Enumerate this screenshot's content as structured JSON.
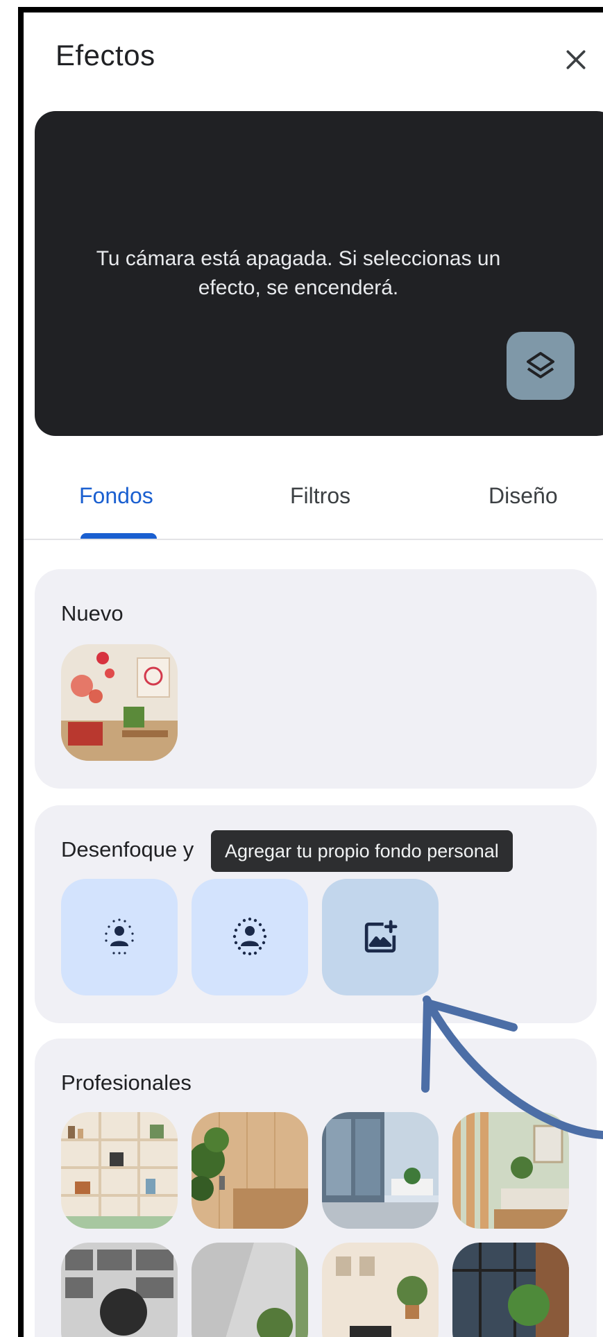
{
  "header": {
    "title": "Efectos"
  },
  "preview": {
    "message": "Tu cámara está apagada. Si seleccionas un efecto, se encenderá."
  },
  "tabs": [
    {
      "label": "Fondos",
      "active": true
    },
    {
      "label": "Filtros",
      "active": false
    },
    {
      "label": "Diseño",
      "active": false
    }
  ],
  "sections": {
    "new": {
      "title": "Nuevo"
    },
    "blur": {
      "title": "Desenfoque y",
      "tooltip": "Agregar tu propio fondo personal"
    },
    "professional": {
      "title": "Profesionales"
    }
  },
  "colors": {
    "accent": "#1a5fd0",
    "preview_bg": "#202124",
    "tile_bg": "#d3e3fd",
    "arrow": "#4c6ea6"
  }
}
